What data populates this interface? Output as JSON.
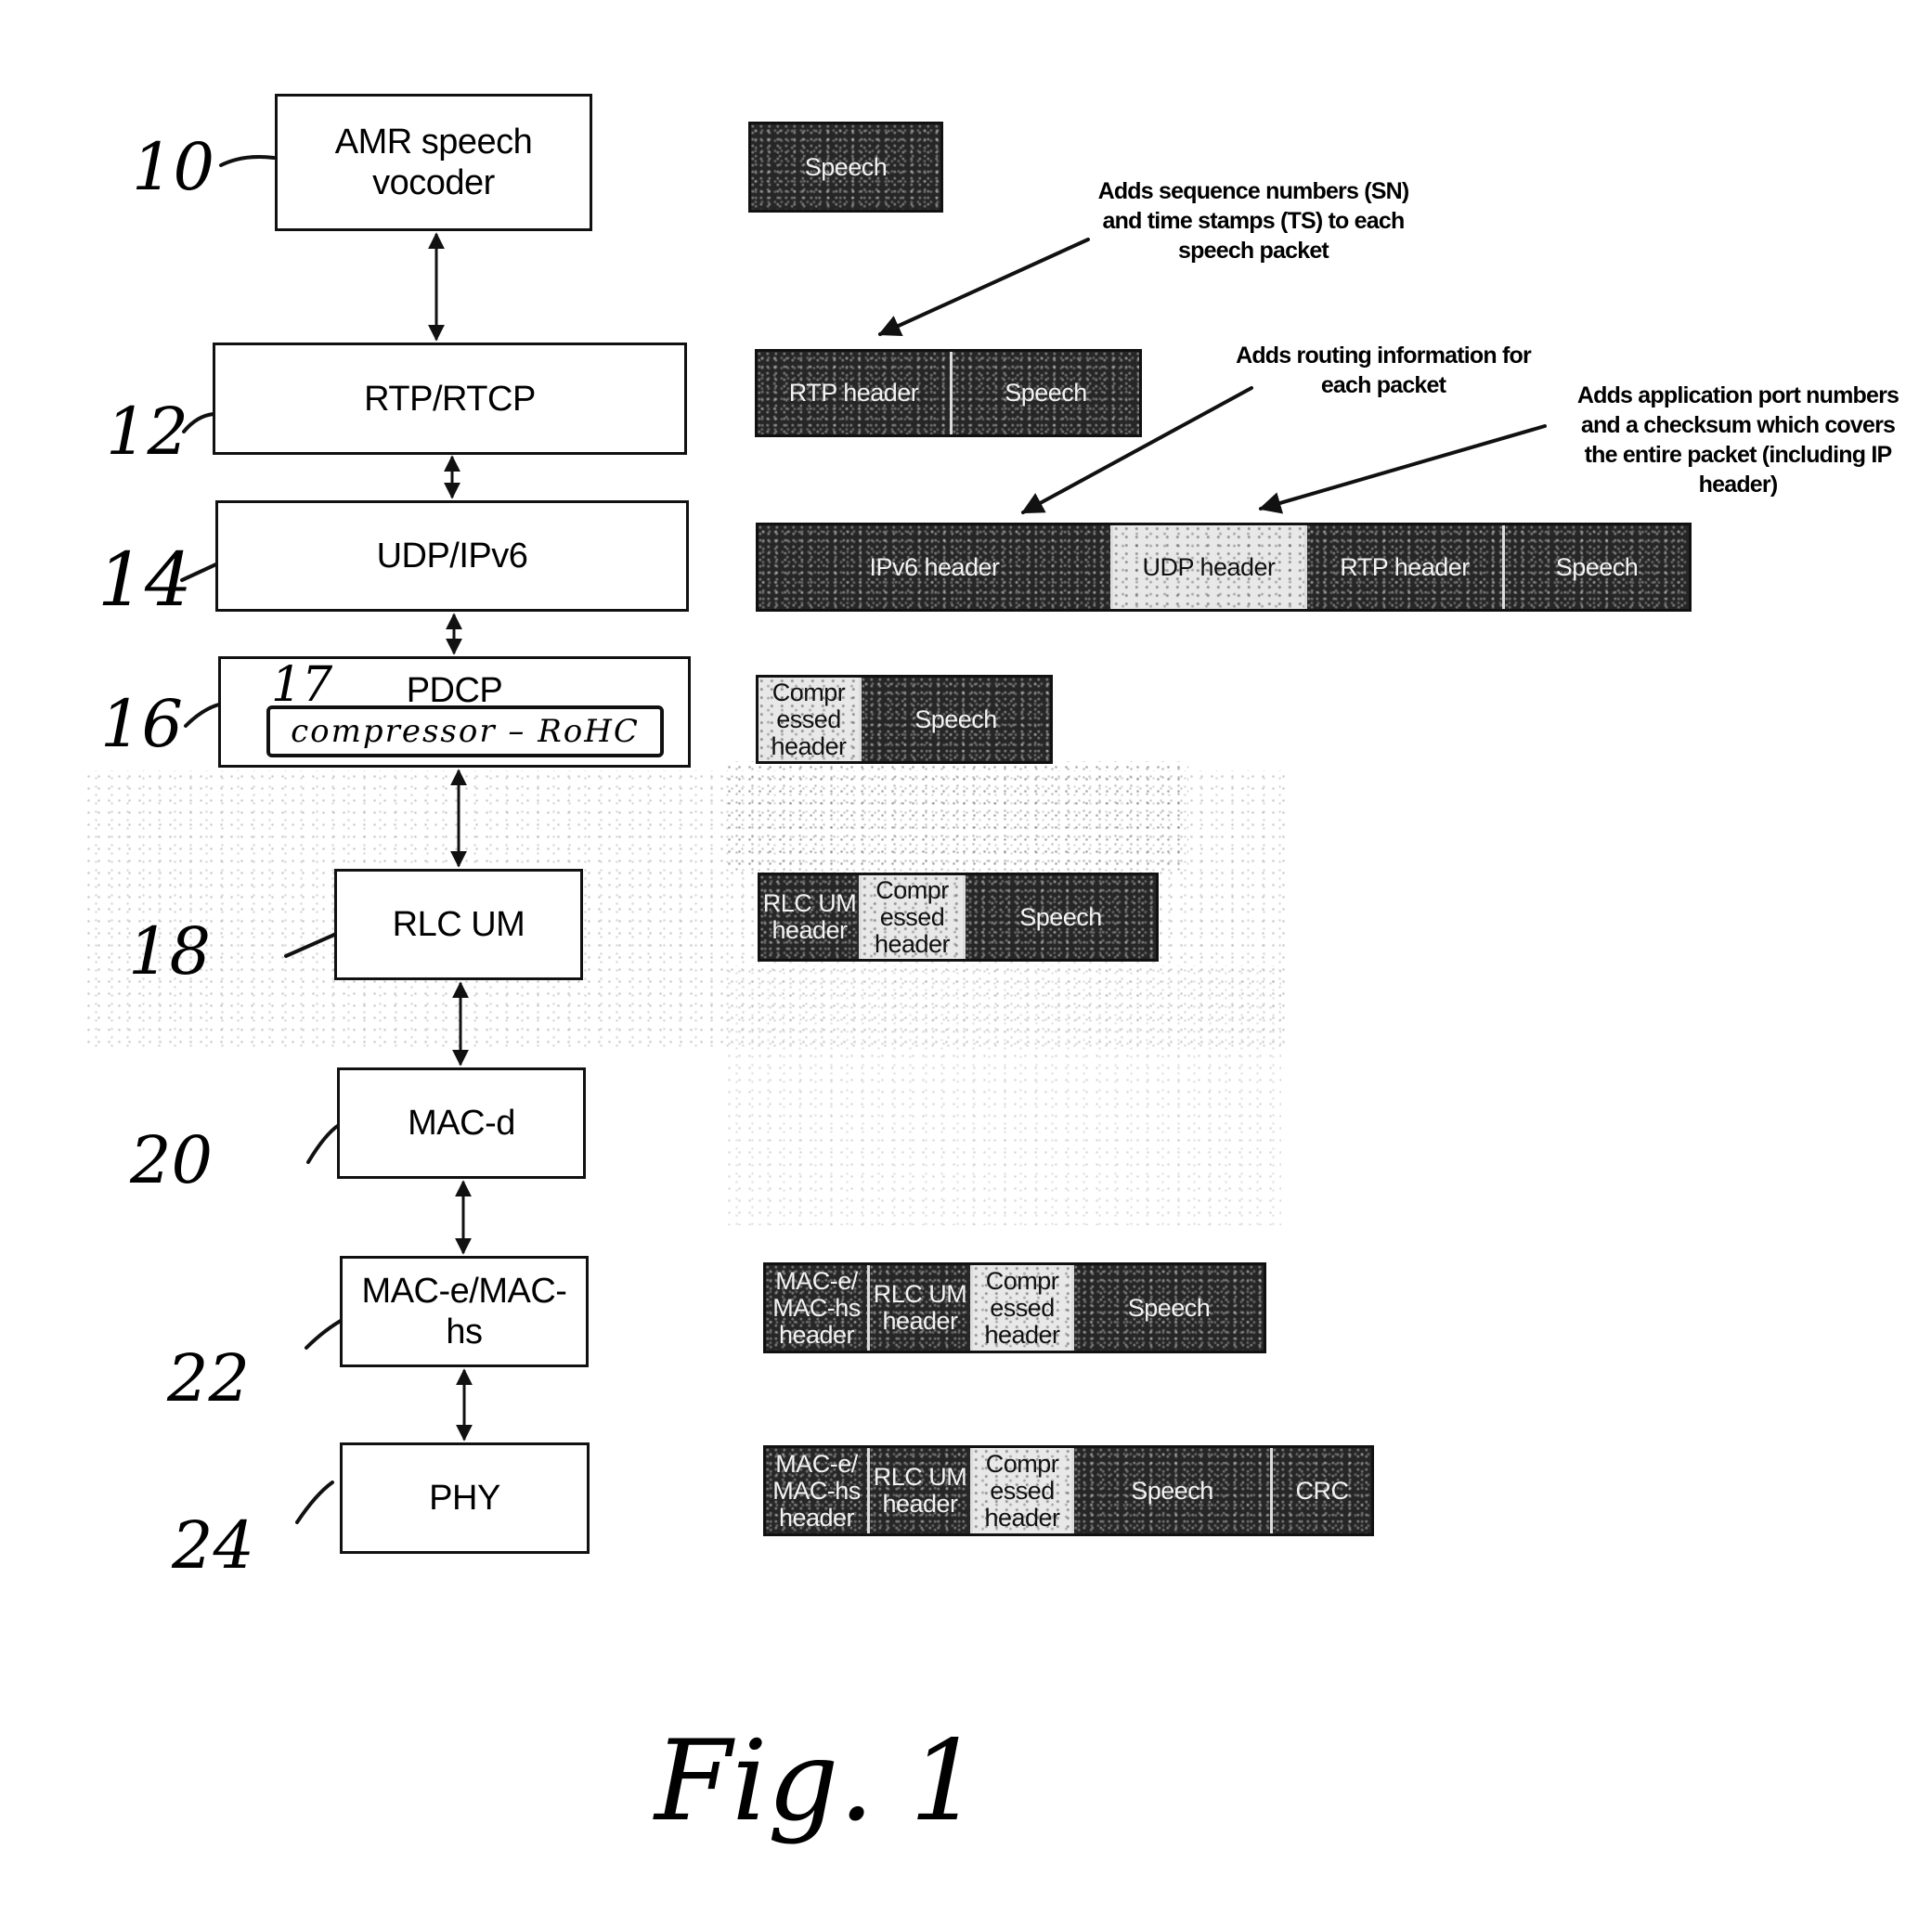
{
  "figure": {
    "caption": "Fig. 1"
  },
  "layers": [
    {
      "id": "amr",
      "ref": "10",
      "lines": [
        "AMR speech",
        "vocoder"
      ]
    },
    {
      "id": "rtp",
      "ref": "12",
      "lines": [
        "RTP/RTCP"
      ]
    },
    {
      "id": "udp",
      "ref": "14",
      "lines": [
        "UDP/IPv6"
      ]
    },
    {
      "id": "pdcp",
      "ref": "16",
      "lines": [
        "PDCP"
      ],
      "sub_ref": "17",
      "sub_label": "compressor – RoHC"
    },
    {
      "id": "rlc",
      "ref": "18",
      "lines": [
        "RLC UM"
      ]
    },
    {
      "id": "macd",
      "ref": "20",
      "lines": [
        "MAC-d"
      ]
    },
    {
      "id": "mace",
      "ref": "22",
      "lines": [
        "MAC-e/MAC-",
        "hs"
      ]
    },
    {
      "id": "phy",
      "ref": "24",
      "lines": [
        "PHY"
      ]
    }
  ],
  "packets": [
    {
      "layer": "amr",
      "segments": [
        {
          "label": "Speech",
          "shade": "dark"
        }
      ]
    },
    {
      "layer": "rtp",
      "segments": [
        {
          "label": "RTP header",
          "shade": "dark"
        },
        {
          "label": "Speech",
          "shade": "dark"
        }
      ]
    },
    {
      "layer": "udp",
      "segments": [
        {
          "label": "IPv6 header",
          "shade": "dark"
        },
        {
          "label": "UDP header",
          "shade": "light"
        },
        {
          "label": "RTP header",
          "shade": "dark"
        },
        {
          "label": "Speech",
          "shade": "dark"
        }
      ]
    },
    {
      "layer": "pdcp",
      "segments": [
        {
          "label": "Compr essed header",
          "shade": "light"
        },
        {
          "label": "Speech",
          "shade": "dark"
        }
      ]
    },
    {
      "layer": "rlc",
      "segments": [
        {
          "label": "RLC UM header",
          "shade": "dark"
        },
        {
          "label": "Compr essed header",
          "shade": "light"
        },
        {
          "label": "Speech",
          "shade": "dark"
        }
      ]
    },
    {
      "layer": "mace",
      "segments": [
        {
          "label": "MAC-e/ MAC-hs header",
          "shade": "dark"
        },
        {
          "label": "RLC UM header",
          "shade": "dark"
        },
        {
          "label": "Compr essed header",
          "shade": "light"
        },
        {
          "label": "Speech",
          "shade": "dark"
        }
      ]
    },
    {
      "layer": "phy",
      "segments": [
        {
          "label": "MAC-e/ MAC-hs header",
          "shade": "dark"
        },
        {
          "label": "RLC UM header",
          "shade": "dark"
        },
        {
          "label": "Compr essed header",
          "shade": "light"
        },
        {
          "label": "Speech",
          "shade": "dark"
        },
        {
          "label": "CRC",
          "shade": "dark"
        }
      ]
    }
  ],
  "annotations": [
    {
      "id": "sn-ts",
      "target": "RTP header",
      "lines": [
        "Adds sequence numbers (SN)",
        "and time stamps (TS) to each",
        "speech packet"
      ]
    },
    {
      "id": "routing",
      "target": "IPv6 header",
      "lines": [
        "Adds routing information for",
        "each packet"
      ]
    },
    {
      "id": "port-checksum",
      "target": "UDP header",
      "lines": [
        "Adds application port numbers",
        "and a checksum which covers",
        "the entire packet (including IP",
        "header)"
      ]
    }
  ],
  "colors": {
    "ink": "#111111",
    "dark_segment": "#262626",
    "light_segment": "#e8e8e8",
    "paper": "#ffffff"
  }
}
